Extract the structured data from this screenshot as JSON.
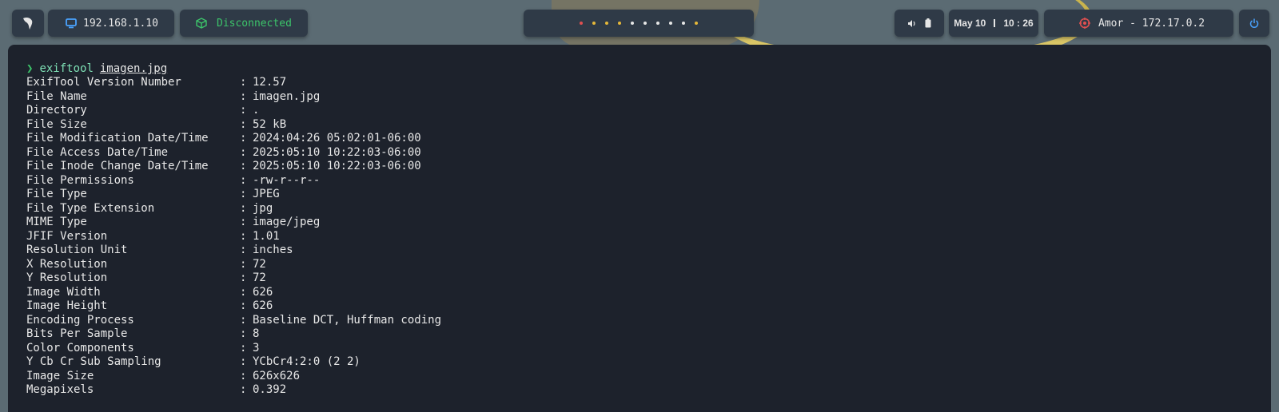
{
  "topbar": {
    "ip": "192.168.1.10",
    "vpn_status": "Disconnected",
    "date": "May 10",
    "time": "10 : 26",
    "target": "Amor - 172.17.0.2",
    "workspace_colors": [
      "#e05050",
      "#e6b83a",
      "#e6b83a",
      "#e6b83a",
      "#e6e6e6",
      "#e6e6e6",
      "#e6e6e6",
      "#e6e6e6",
      "#e6e6e6",
      "#e6b83a"
    ]
  },
  "terminal": {
    "prompt_symbol": "❯",
    "command": "exiftool",
    "argument": "imagen.jpg",
    "separator": ":",
    "rows": [
      {
        "key": "ExifTool Version Number",
        "value": "12.57"
      },
      {
        "key": "File Name",
        "value": "imagen.jpg"
      },
      {
        "key": "Directory",
        "value": "."
      },
      {
        "key": "File Size",
        "value": "52 kB"
      },
      {
        "key": "File Modification Date/Time",
        "value": "2024:04:26 05:02:01-06:00"
      },
      {
        "key": "File Access Date/Time",
        "value": "2025:05:10 10:22:03-06:00"
      },
      {
        "key": "File Inode Change Date/Time",
        "value": "2025:05:10 10:22:03-06:00"
      },
      {
        "key": "File Permissions",
        "value": "-rw-r--r--"
      },
      {
        "key": "File Type",
        "value": "JPEG"
      },
      {
        "key": "File Type Extension",
        "value": "jpg"
      },
      {
        "key": "MIME Type",
        "value": "image/jpeg"
      },
      {
        "key": "JFIF Version",
        "value": "1.01"
      },
      {
        "key": "Resolution Unit",
        "value": "inches"
      },
      {
        "key": "X Resolution",
        "value": "72"
      },
      {
        "key": "Y Resolution",
        "value": "72"
      },
      {
        "key": "Image Width",
        "value": "626"
      },
      {
        "key": "Image Height",
        "value": "626"
      },
      {
        "key": "Encoding Process",
        "value": "Baseline DCT, Huffman coding"
      },
      {
        "key": "Bits Per Sample",
        "value": "8"
      },
      {
        "key": "Color Components",
        "value": "3"
      },
      {
        "key": "Y Cb Cr Sub Sampling",
        "value": "YCbCr4:2:0 (2 2)"
      },
      {
        "key": "Image Size",
        "value": "626x626"
      },
      {
        "key": "Megapixels",
        "value": "0.392"
      }
    ]
  }
}
